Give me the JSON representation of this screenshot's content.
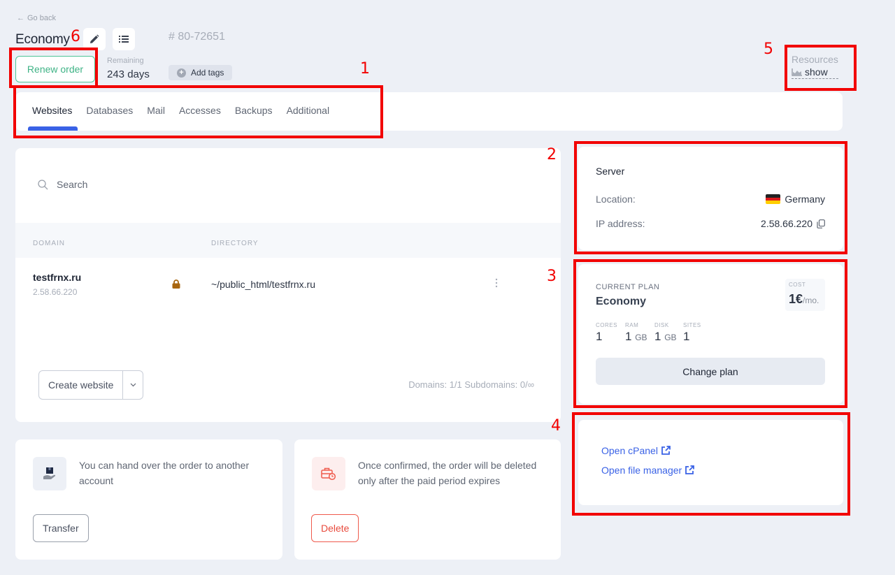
{
  "header": {
    "go_back_label": "Go back",
    "title": "Economy",
    "order_id": "# 80-72651",
    "renew_label": "Renew order",
    "remaining_label": "Remaining",
    "remaining_value": "243 days",
    "add_tags_label": "Add tags",
    "resources_label": "Resources",
    "resources_show_label": "show"
  },
  "tabs": [
    {
      "label": "Websites",
      "active": true
    },
    {
      "label": "Databases",
      "active": false
    },
    {
      "label": "Mail",
      "active": false
    },
    {
      "label": "Accesses",
      "active": false
    },
    {
      "label": "Backups",
      "active": false
    },
    {
      "label": "Additional",
      "active": false
    }
  ],
  "websites": {
    "search_placeholder": "Search",
    "columns": [
      "DOMAIN",
      "DIRECTORY"
    ],
    "rows": [
      {
        "domain": "testfrnx.ru",
        "ip": "2.58.66.220",
        "ssl": true,
        "directory": "~/public_html/testfrnx.ru"
      }
    ],
    "create_label": "Create website",
    "counts": "Domains: 1/1  Subdomains: 0/∞"
  },
  "transfer": {
    "text": "You can hand over the order to another account",
    "button_label": "Transfer"
  },
  "delete": {
    "text": "Once confirmed, the order will be deleted only after the paid period expires",
    "button_label": "Delete"
  },
  "server": {
    "title": "Server",
    "location_label": "Location:",
    "location_value": "Germany",
    "ip_label": "IP address:",
    "ip_value": "2.58.66.220"
  },
  "plan": {
    "label": "CURRENT PLAN",
    "name": "Economy",
    "cost_label": "COST",
    "cost_value": "1€",
    "cost_unit": "/mo.",
    "specs": [
      {
        "key": "CORES",
        "value": "1",
        "unit": ""
      },
      {
        "key": "RAM",
        "value": "1",
        "unit": "GB"
      },
      {
        "key": "DISK",
        "value": "1",
        "unit": "GB"
      },
      {
        "key": "SITES",
        "value": "1",
        "unit": ""
      }
    ],
    "change_label": "Change plan"
  },
  "links": {
    "cpanel_label": "Open cPanel",
    "file_manager_label": "Open file manager"
  },
  "annotations": [
    "1",
    "2",
    "3",
    "4",
    "5",
    "6"
  ],
  "colors": {
    "accent": "#3a62e6",
    "renew": "#3fb386",
    "danger": "#e84a3c",
    "annotation": "#f20000"
  }
}
